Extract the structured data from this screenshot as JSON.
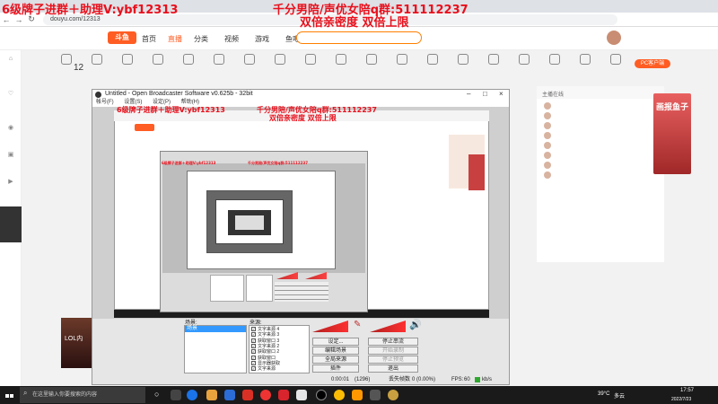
{
  "overlay": {
    "left_banner": "6级牌子进群＋助理V:ybf12313",
    "center_banner": "千分男陪/声优女陪q群:511112237",
    "center_sub": "双倍亲密度 双倍上限"
  },
  "browser": {
    "url": "douyu.com/12313"
  },
  "douyu": {
    "logo": "斗鱼",
    "nav": [
      "首页",
      "直播",
      "分类",
      "视频",
      "游戏",
      "鱼吧"
    ],
    "counter": "12",
    "categories": [
      "",
      "",
      "",
      "",
      "",
      "",
      "",
      "",
      "",
      "",
      "",
      "",
      "",
      "",
      "",
      "",
      "",
      "",
      ""
    ],
    "pc_button": "PC客户端",
    "right_panel_title": "主播在线",
    "right_rows": [
      "",
      "",
      "",
      "",
      "",
      "",
      "",
      ""
    ],
    "right_desc": "",
    "gift_card": "画报鱼子",
    "lol_banner": "LOL内"
  },
  "obs": {
    "title": "Untitled - Open Broadcaster Software v0.625b - 32bit",
    "menu": [
      "帐号(F)",
      "设置(S)",
      "设定(P)",
      "帮助(H)"
    ],
    "preview_left_banner": "6级牌子进群＋助理V:ybf12313",
    "preview_center_banner": "千分男陪/声优女陪q群:511112237",
    "preview_center_sub": "双倍亲密度 双倍上限",
    "scenes_label": "场景:",
    "sources_label": "来源:",
    "scene_selected": "场景",
    "sources": [
      "文字来源 4",
      "文字来源 3",
      "获取窗口 3",
      "文字来源 2",
      "获取窗口 2",
      "获取窗口",
      "显示器获取",
      "文字来源"
    ],
    "buttons": {
      "settings": "设定...",
      "start_stream": "停止串流",
      "edit_scene": "编辑场景",
      "record": "开始录制",
      "global_sources": "全局来源",
      "preview": "停止预览",
      "plugins": "插件",
      "exit": "退出"
    },
    "status": {
      "time": "0:00:01",
      "dropped": "(1296)",
      "dropped_label": "丢失帧数",
      "dropped_value": "0 (0.00%)",
      "fps_label": "FPS:",
      "fps": "60",
      "kbps_label": "kb/s"
    }
  },
  "taskbar": {
    "search_placeholder": "在这里输入你要搜索的内容",
    "temperature": "39°C",
    "weather": "多云",
    "time": "17:57",
    "date": "2022/7/23"
  }
}
